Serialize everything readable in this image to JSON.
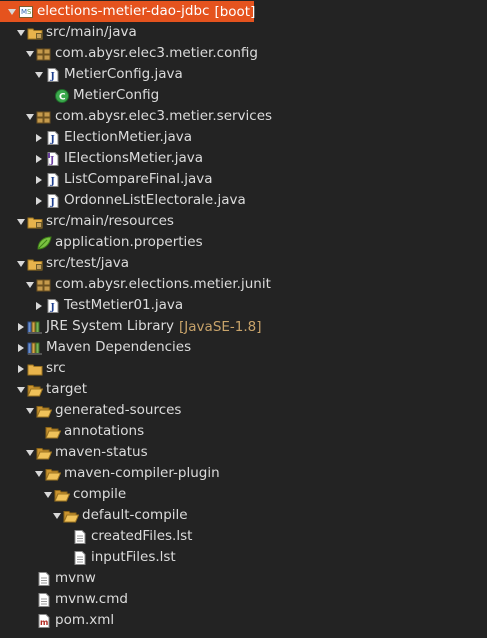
{
  "tree": [
    {
      "label": "elections-metier-dao-jdbc",
      "decoration": "[boot]",
      "icon": "project-icon",
      "state": "open",
      "selected": true
    },
    {
      "label": "src/main/java",
      "icon": "source-folder-icon",
      "state": "open"
    },
    {
      "label": "com.abysr.elec3.metier.config",
      "icon": "package-icon",
      "state": "open"
    },
    {
      "label": "MetierConfig.java",
      "icon": "java-file-icon",
      "state": "open"
    },
    {
      "label": "MetierConfig",
      "icon": "class-icon",
      "state": "none"
    },
    {
      "label": "com.abysr.elec3.metier.services",
      "icon": "package-icon",
      "state": "open"
    },
    {
      "label": "ElectionMetier.java",
      "icon": "java-file-icon",
      "state": "closed"
    },
    {
      "label": "IElectionsMetier.java",
      "icon": "java-interface-file-icon",
      "state": "closed"
    },
    {
      "label": "ListCompareFinal.java",
      "icon": "java-file-icon",
      "state": "closed"
    },
    {
      "label": "OrdonneListElectorale.java",
      "icon": "java-file-icon",
      "state": "closed"
    },
    {
      "label": "src/main/resources",
      "icon": "source-folder-icon",
      "state": "open"
    },
    {
      "label": "application.properties",
      "icon": "spring-leaf-icon",
      "state": "none"
    },
    {
      "label": "src/test/java",
      "icon": "source-folder-icon",
      "state": "open"
    },
    {
      "label": "com.abysr.elections.metier.junit",
      "icon": "package-icon",
      "state": "open"
    },
    {
      "label": "TestMetier01.java",
      "icon": "java-file-icon",
      "state": "closed"
    },
    {
      "label": "JRE System Library",
      "decoration": "[JavaSE-1.8]",
      "icon": "library-icon",
      "state": "closed"
    },
    {
      "label": "Maven Dependencies",
      "icon": "library-icon",
      "state": "closed"
    },
    {
      "label": "src",
      "icon": "folder-icon",
      "state": "closed"
    },
    {
      "label": "target",
      "icon": "folder-open-icon",
      "state": "open"
    },
    {
      "label": "generated-sources",
      "icon": "folder-open-icon",
      "state": "open"
    },
    {
      "label": "annotations",
      "icon": "folder-open-icon",
      "state": "none"
    },
    {
      "label": "maven-status",
      "icon": "folder-open-icon",
      "state": "open"
    },
    {
      "label": "maven-compiler-plugin",
      "icon": "folder-open-icon",
      "state": "open"
    },
    {
      "label": "compile",
      "icon": "folder-open-icon",
      "state": "open"
    },
    {
      "label": "default-compile",
      "icon": "folder-open-icon",
      "state": "open"
    },
    {
      "label": "createdFiles.lst",
      "icon": "text-file-icon",
      "state": "none"
    },
    {
      "label": "inputFiles.lst",
      "icon": "text-file-icon",
      "state": "none"
    },
    {
      "label": "mvnw",
      "icon": "text-file-icon",
      "state": "none"
    },
    {
      "label": "mvnw.cmd",
      "icon": "text-file-icon",
      "state": "none"
    },
    {
      "label": "pom.xml",
      "icon": "maven-pom-icon",
      "state": "none"
    }
  ]
}
